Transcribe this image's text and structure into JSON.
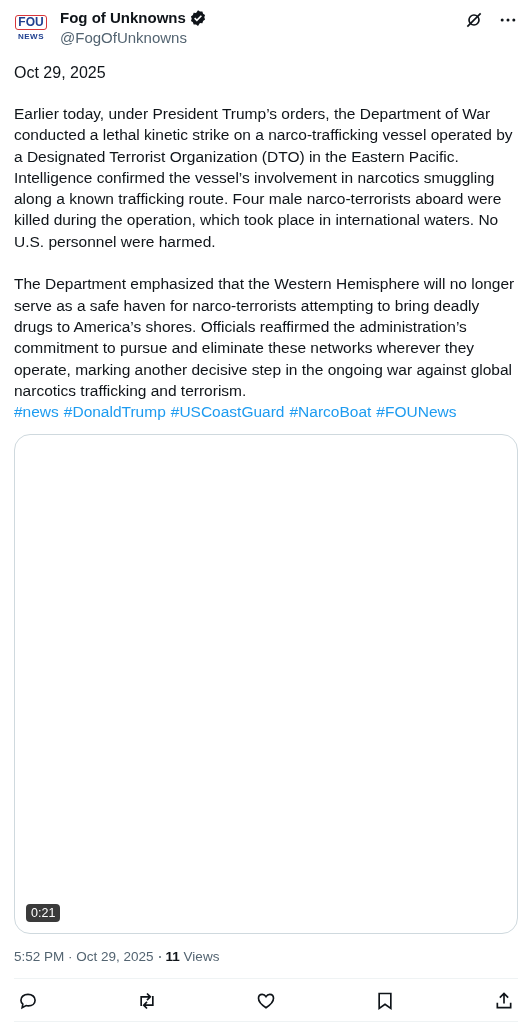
{
  "author": {
    "logo_top": "FOU",
    "logo_bottom": "NEWS",
    "name": "Fog of Unknowns",
    "verified": true,
    "handle": "@FogOfUnknowns"
  },
  "date_line": "Oct 29, 2025",
  "paragraphs": [
    "Earlier today, under President Trump’s orders, the Department of War conducted a lethal kinetic strike on a narco-trafficking vessel operated by a Designated Terrorist Organization (DTO) in the Eastern Pacific. Intelligence confirmed the vessel’s involvement in narcotics smuggling along a known trafficking route. Four male narco-terrorists aboard were killed during the operation, which took place in international waters. No U.S. personnel were harmed.",
    "The Department emphasized that the Western Hemisphere will no longer serve as a safe haven for narco-terrorists attempting to bring deadly drugs to America’s shores. Officials reaffirmed the administration’s commitment to pursue and eliminate these networks wherever they operate, marking another decisive step in the ongoing war against global narcotics trafficking and terrorism."
  ],
  "hashtags": [
    "#news",
    "#DonaldTrump",
    "#USCoastGuard",
    "#NarcoBoat",
    "#FOUNews"
  ],
  "video": {
    "duration": "0:21"
  },
  "meta": {
    "time": "5:52 PM · Oct 29, 2025",
    "views": "**11** Views"
  },
  "actions": [
    {
      "kind": "reply"
    },
    {
      "kind": "repost"
    },
    {
      "kind": "like"
    },
    {
      "kind": "bookmark"
    },
    {
      "kind": "share"
    }
  ]
}
